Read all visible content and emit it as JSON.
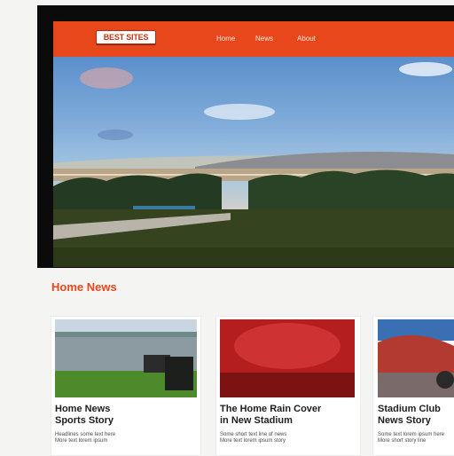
{
  "header": {
    "logo_text": "BEST SITES",
    "nav": [
      "Home",
      "News",
      "About"
    ],
    "accent_color": "#e8471c"
  },
  "section": {
    "title": "Home News"
  },
  "cards": [
    {
      "title": "Home News\nSports Story",
      "text": "Headlines some text here\nMore text lorem ipsum"
    },
    {
      "title": "The Home Rain Cover\nin New Stadium",
      "text": "Some short text line of news\nMore text lorem ipsum story"
    },
    {
      "title": "Stadium Club\nNews Story",
      "text": "Some text lorem ipsum here\nMore short story line"
    }
  ]
}
